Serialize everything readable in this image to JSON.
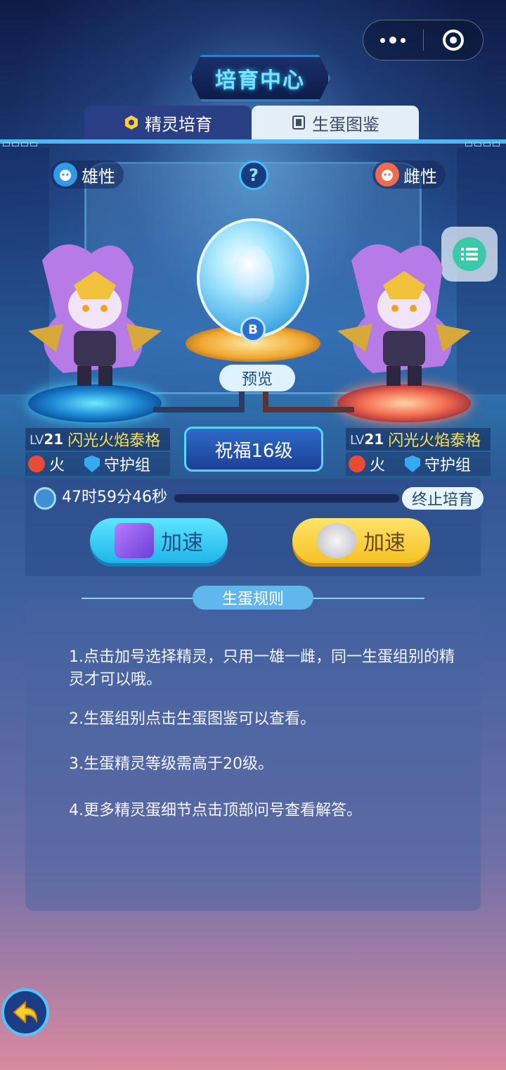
{
  "header": {
    "title": "培育中心",
    "tabs": [
      {
        "label": "精灵培育",
        "active": true
      },
      {
        "label": "生蛋图鉴",
        "active": false
      }
    ]
  },
  "parents": {
    "male": {
      "gender_label": "雄性",
      "level_prefix": "LV",
      "level": "21",
      "name": "闪光火焰泰格",
      "element": "火",
      "group": "守护组"
    },
    "female": {
      "gender_label": "雌性",
      "level_prefix": "LV",
      "level": "21",
      "name": "闪光火焰泰格",
      "element": "火",
      "group": "守护组"
    }
  },
  "egg": {
    "badge": "B",
    "preview_label": "预览",
    "help_label": "?"
  },
  "blessing": "祝福16级",
  "timer": {
    "remaining": "47时59分46秒",
    "progress": 0,
    "stop_label": "终止培育",
    "speed_video_label": "加速",
    "speed_item_label": "加速"
  },
  "rules": {
    "title": "生蛋规则",
    "items": [
      "1.点击加号选择精灵，只用一雄一雌，同一生蛋组别的精灵才可以哦。",
      "2.生蛋组别点击生蛋图鉴可以查看。",
      "3.生蛋精灵等级需高于20级。",
      "4.更多精灵蛋细节点击顶部问号查看解答。"
    ]
  },
  "colors": {
    "accent_cyan": "#52b6f2",
    "name_yellow": "#ffe14a",
    "speed_blue": "#1fb4ea",
    "speed_yellow": "#f5c224"
  }
}
